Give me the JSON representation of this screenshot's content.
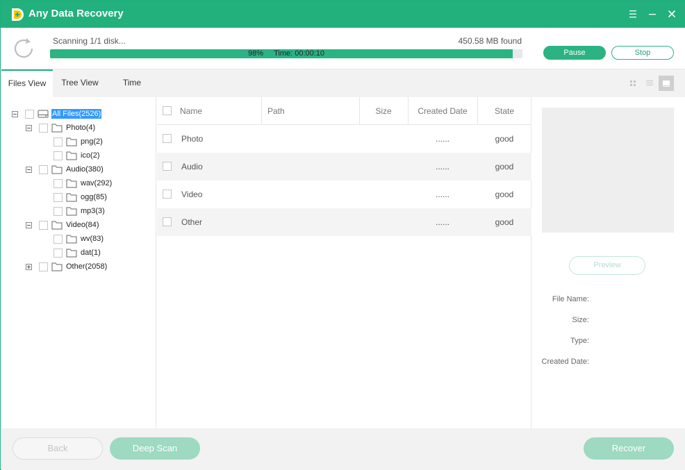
{
  "app": {
    "title": "Any Data Recovery",
    "accent_color": "#22b07d"
  },
  "window_controls": {
    "menu_icon": "menu-icon",
    "minimize_icon": "minimize-icon",
    "close_icon": "close-icon"
  },
  "scan": {
    "status": "Scanning 1/1 disk...",
    "found": "450.58 MB found",
    "progress_percent": 98,
    "progress_label": "98%",
    "time_label": "Time: 00:00:10",
    "pause_label": "Pause",
    "stop_label": "Stop"
  },
  "tabs": [
    {
      "label": "Files View",
      "active": true
    },
    {
      "label": "Tree View",
      "active": false
    },
    {
      "label": "Time",
      "active": false
    }
  ],
  "view_modes": [
    "grid-view-icon",
    "list-view-icon",
    "detail-view-icon"
  ],
  "tree": {
    "root": "All Files(2526)",
    "nodes": [
      {
        "label": "Photo(4)",
        "expanded": true,
        "children": [
          "png(2)",
          "ico(2)"
        ]
      },
      {
        "label": "Audio(380)",
        "expanded": true,
        "children": [
          "wav(292)",
          "ogg(85)",
          "mp3(3)"
        ]
      },
      {
        "label": "Video(84)",
        "expanded": true,
        "children": [
          "wv(83)",
          "dat(1)"
        ]
      },
      {
        "label": "Other(2058)",
        "expanded": false,
        "children": []
      }
    ]
  },
  "file_list": {
    "columns": [
      "Name",
      "Path",
      "Size",
      "Created Date",
      "State"
    ],
    "rows": [
      {
        "name": "Photo",
        "path": "",
        "size": "",
        "created": "......",
        "state": "good"
      },
      {
        "name": "Audio",
        "path": "",
        "size": "",
        "created": "......",
        "state": "good"
      },
      {
        "name": "Video",
        "path": "",
        "size": "",
        "created": "......",
        "state": "good"
      },
      {
        "name": "Other",
        "path": "",
        "size": "",
        "created": "......",
        "state": "good"
      }
    ]
  },
  "preview": {
    "button_label": "Preview",
    "file_name_label": "File Name:",
    "size_label": "Size:",
    "type_label": "Type:",
    "created_label": "Created Date:"
  },
  "footer": {
    "back_label": "Back",
    "deep_scan_label": "Deep Scan",
    "recover_label": "Recover"
  }
}
